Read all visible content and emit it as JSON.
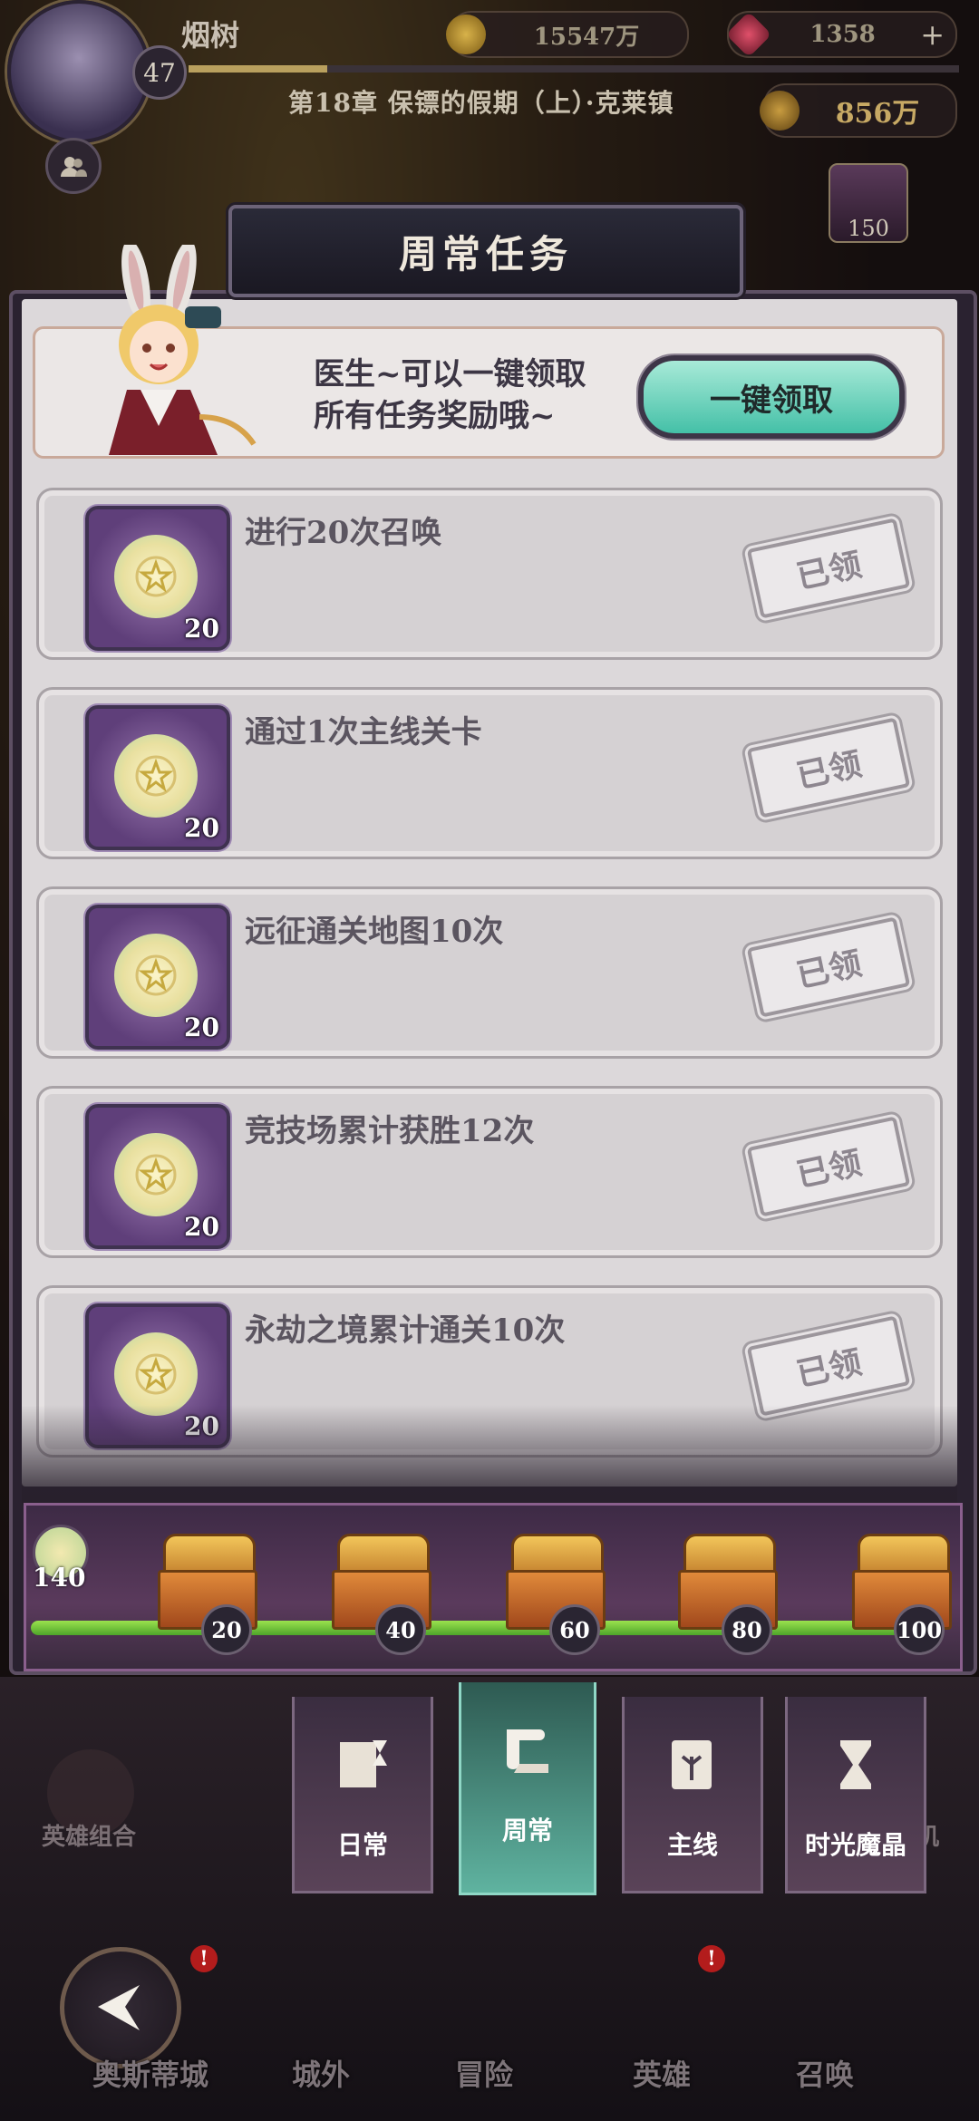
{
  "player": {
    "name": "烟树",
    "level": "47",
    "chapter": "第18章 保镖的假期（上）·克莱镇"
  },
  "resources": {
    "gold": "15547万",
    "gems": "1358",
    "power": "856万",
    "reward_card_count": "150"
  },
  "panel": {
    "title": "周常任务"
  },
  "promo": {
    "text_line1": "医生~可以一键领取",
    "text_line2": "所有任务奖励哦~",
    "claim_all_label": "一键领取"
  },
  "tasks": [
    {
      "label": "进行20次召唤",
      "reward_qty": "20",
      "status": "已领"
    },
    {
      "label": "通过1次主线关卡",
      "reward_qty": "20",
      "status": "已领"
    },
    {
      "label": "远征通关地图10次",
      "reward_qty": "20",
      "status": "已领"
    },
    {
      "label": "竞技场累计获胜12次",
      "reward_qty": "20",
      "status": "已领"
    },
    {
      "label": "永劫之境累计通关10次",
      "reward_qty": "20",
      "status": "已领"
    }
  ],
  "progress": {
    "points": "140",
    "fill_fraction": 1.0,
    "milestones": [
      "20",
      "40",
      "60",
      "80",
      "100"
    ]
  },
  "tabs": [
    {
      "label": "日常"
    },
    {
      "label": "周常"
    },
    {
      "label": "主线"
    },
    {
      "label": "时光魔晶"
    }
  ],
  "lower": {
    "left_label": "英雄组合",
    "right_label": "机"
  },
  "nav": [
    {
      "label": "奥斯蒂城"
    },
    {
      "label": "城外"
    },
    {
      "label": "冒险"
    },
    {
      "label": "英雄"
    },
    {
      "label": "召唤"
    }
  ],
  "badges": {
    "alert": "!"
  }
}
